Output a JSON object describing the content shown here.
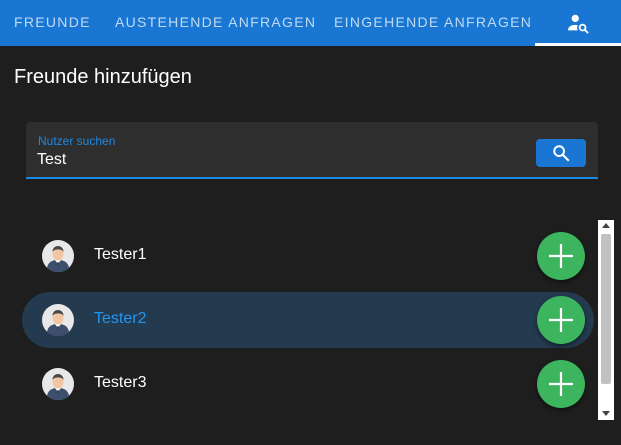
{
  "tabs": [
    {
      "label": "Freunde"
    },
    {
      "label": "Austehende Anfragen"
    },
    {
      "label": "Eingehende Anfragen"
    }
  ],
  "active_tab_icon": "person-search-icon",
  "title": "Freunde hinzufügen",
  "search": {
    "label": "Nutzer suchen",
    "value": "Test",
    "button_icon": "search-icon"
  },
  "results": [
    {
      "name": "Tester1",
      "avatar": "user-avatar-icon",
      "action_icon": "plus-icon"
    },
    {
      "name": "Tester2",
      "avatar": "user-avatar-icon",
      "action_icon": "plus-icon",
      "highlighted": true
    },
    {
      "name": "Tester3",
      "avatar": "user-avatar-icon",
      "action_icon": "plus-icon"
    }
  ],
  "colors": {
    "primary": "#1976d2",
    "background": "#1e1e1e",
    "add_button": "#3cb55e",
    "highlight_row": "#243a4f",
    "highlight_text": "#2196f3"
  }
}
